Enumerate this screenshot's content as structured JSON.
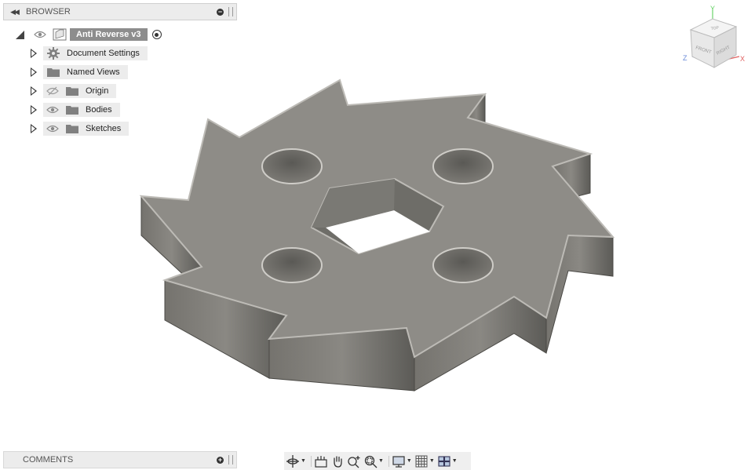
{
  "browser": {
    "title": "BROWSER",
    "root": {
      "label": "Anti Reverse v3"
    },
    "items": [
      {
        "label": "Document Settings",
        "icon": "gear-icon"
      },
      {
        "label": "Named Views",
        "icon": "folder-icon"
      },
      {
        "label": "Origin",
        "icon": "folder-icon",
        "visibility": "hidden-eye-icon"
      },
      {
        "label": "Bodies",
        "icon": "folder-icon",
        "visibility": "eye-icon"
      },
      {
        "label": "Sketches",
        "icon": "folder-icon",
        "visibility": "eye-icon"
      }
    ]
  },
  "comments": {
    "title": "COMMENTS"
  },
  "viewcube": {
    "top": "TOP",
    "front": "FRONT",
    "right": "RIGHT",
    "axis_x": "X",
    "axis_y": "Y",
    "axis_z": "Z"
  },
  "toolbar": {
    "buttons": [
      "orbit-icon",
      "look-at-icon",
      "pan-icon",
      "zoom-icon",
      "fit-icon",
      "display-settings-icon",
      "grid-icon",
      "viewports-icon"
    ]
  },
  "colors": {
    "model_face": "#8e8c87",
    "model_side": "#6a6964",
    "root_label_bg": "#8d8d8d",
    "panel_bg": "#ececec"
  }
}
